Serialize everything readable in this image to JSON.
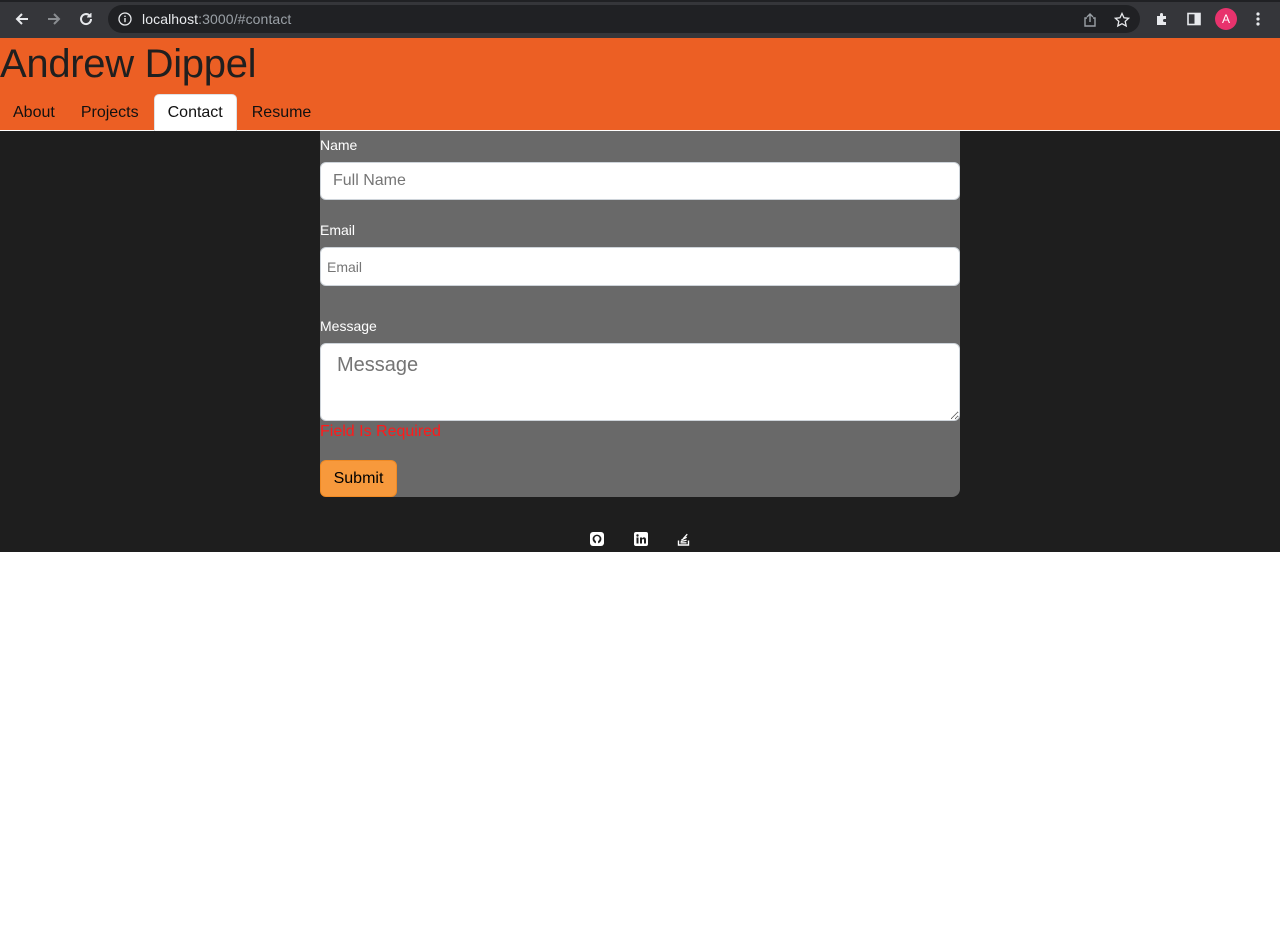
{
  "browser": {
    "url_host": "localhost",
    "url_path": ":3000/#contact",
    "profile_initial": "A"
  },
  "site": {
    "title": "Andrew Dippel",
    "tabs": [
      "About",
      "Projects",
      "Contact",
      "Resume"
    ],
    "active_tab": "Contact"
  },
  "form": {
    "name_label": "Name",
    "name_placeholder": "Full Name",
    "email_label": "Email",
    "email_placeholder": "Email",
    "message_label": "Message",
    "message_placeholder": "Message",
    "error_text": "Field Is Required",
    "submit_label": "Submit"
  },
  "footer": {
    "icons": [
      "github-icon",
      "linkedin-icon",
      "stackoverflow-icon"
    ]
  },
  "colors": {
    "header_bg": "#ec5f24",
    "page_bg": "#1e1e1e",
    "card_bg": "#696969",
    "error": "#ff1a1a",
    "submit_bg": "#f7993c"
  }
}
